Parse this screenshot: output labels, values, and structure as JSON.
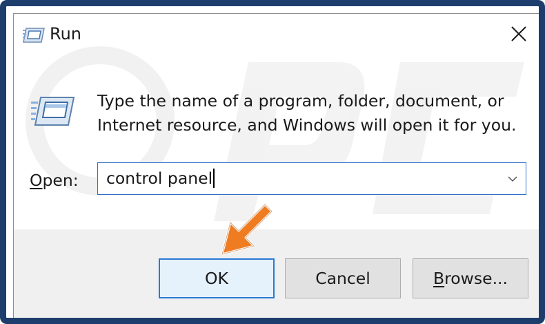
{
  "window": {
    "title": "Run",
    "description_line1": "Type the name of a program, folder, document, or",
    "description_line2": "Internet resource, and Windows will open it for you."
  },
  "open_field": {
    "label_accel": "O",
    "label_rest": "pen:",
    "value": "control panel"
  },
  "buttons": {
    "ok": "OK",
    "cancel": "Cancel",
    "browse_accel": "B",
    "browse_rest": "rowse..."
  },
  "icons": {
    "title_icon": "run-icon",
    "close": "close-icon",
    "dropdown": "chevron-down-icon",
    "annotation": "pointer-arrow-icon"
  },
  "colors": {
    "frame": "#1d3e6c",
    "focus_blue": "#2c78d4",
    "annotation_orange": "#f07c22"
  }
}
